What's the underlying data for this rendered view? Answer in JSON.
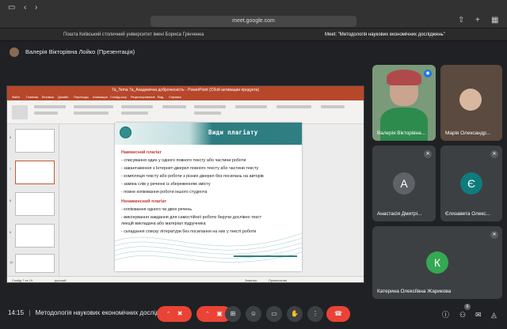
{
  "browser": {
    "url": "meet.google.com",
    "tabs": [
      {
        "label": "Пошта Київський столичний університет імені Бориса Грінченка"
      },
      {
        "label": "Meet: \"Методологія наукових економічних досліджень\""
      }
    ]
  },
  "presentation": {
    "presenter_label": "Валерія Вікторівна Лойко (Презентація)",
    "ppt_title": "7a_Tema 7a_Академічна доброчесність - PowerPoint (Сбой активации продукта)",
    "ppt_tabs": [
      "Файл",
      "Главная",
      "Вставка",
      "Дизайн",
      "Переходы",
      "Анимация",
      "Слайд-шоу",
      "Рецензирование",
      "Вид",
      "Справка"
    ],
    "status_left": "Слайд 7 из 19",
    "status_lang": "русский",
    "status_zoom": "Заметки",
    "status_view": "Примечания",
    "slide": {
      "heading": "Види плагіату",
      "sections": [
        {
          "title": "Навмисний плагіат",
          "items": [
            "- списування один у одного повного тексту або частини роботи",
            "- завантаження з Інтернет-джерел повного тексту або частини тексту",
            "- компіляція тексту або роботи з різних джерел без посилань на авторів",
            "- заміна слів у реченні із збереженням змісту",
            "- повне копіювання роботи іншого студента"
          ]
        },
        {
          "title": "Ненавмисний плагіат",
          "items": [
            "- копіювання одного чи двох речень",
            "- виконування завдання для самостійної роботи беручи дослівно текст",
            "  лекцій викладача або матеріал підручника",
            "- складання списку літератури без посилання на них у тексті роботи"
          ]
        }
      ]
    }
  },
  "participants": [
    {
      "name": "Валерія Вікторівна...",
      "initial": "",
      "color": "#6b8e6b",
      "muted": false
    },
    {
      "name": "Марія Олександр...",
      "initial": "",
      "color": "#c8a48c",
      "muted": true
    },
    {
      "name": "Анастасія Дмитрі...",
      "initial": "А",
      "color": "#5f6368",
      "muted": true
    },
    {
      "name": "Єлизавета Олекс...",
      "initial": "Є",
      "color": "#0f7c7c",
      "muted": true
    },
    {
      "name": "Катерина Олексіївна Жарикова",
      "initial": "К",
      "color": "#34a853",
      "muted": true
    }
  ],
  "bottom": {
    "time": "14:15",
    "separator": "|",
    "meeting_title": "Методологія наукових економічних дослід...",
    "participant_count": "6",
    "icons": [
      "chevron-up-icon",
      "mic-off-icon",
      "camera-off-icon",
      "present-icon",
      "emoji-icon",
      "captions-icon",
      "raise-hand-icon",
      "more-icon",
      "end-call-icon",
      "info-icon",
      "people-icon",
      "chat-icon",
      "activities-icon"
    ]
  },
  "colors": {
    "accent": "#ea4335",
    "teal": "#2f7f82",
    "plagiarism_red": "#c0392b"
  }
}
